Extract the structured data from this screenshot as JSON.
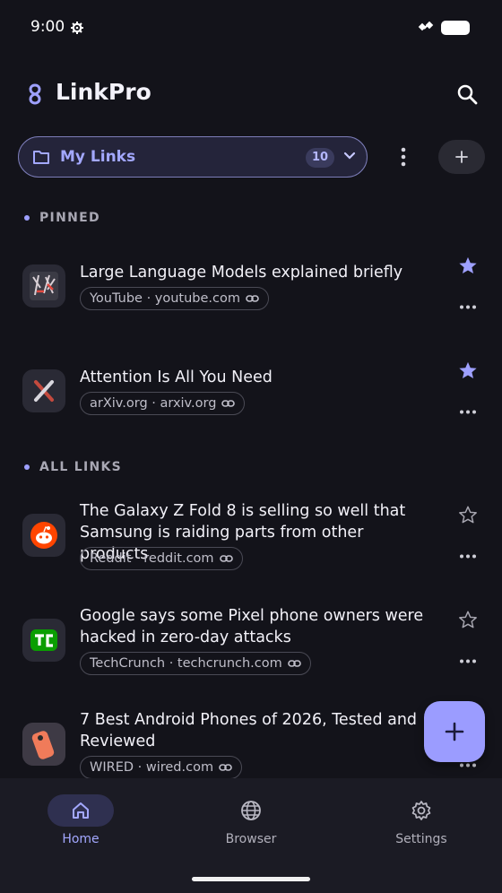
{
  "status_bar": {
    "time": "9:00"
  },
  "app": {
    "title": "LinkPro"
  },
  "collection": {
    "label": "My Links",
    "count": "10"
  },
  "sections": {
    "pinned": "PINNED",
    "all": "ALL LINKS"
  },
  "pinned": [
    {
      "title": "Large Language Models explained briefly",
      "source": "YouTube · youtube.com",
      "starred": true
    },
    {
      "title": "Attention Is All You Need",
      "source": "arXiv.org · arxiv.org",
      "starred": true
    }
  ],
  "links": [
    {
      "title": "The Galaxy Z Fold 8 is selling so well that Samsung is raiding parts from other products",
      "source": "Reddit · reddit.com",
      "starred": false
    },
    {
      "title": "Google says some Pixel phone owners were hacked in zero-day attacks",
      "source": "TechCrunch · techcrunch.com",
      "starred": false
    },
    {
      "title": "7 Best Android Phones of 2026, Tested and Reviewed",
      "source": "WIRED · wired.com",
      "starred": false
    }
  ],
  "nav": {
    "home": "Home",
    "browser": "Browser",
    "settings": "Settings"
  },
  "colors": {
    "accent": "#9b9cff",
    "background": "#13131a",
    "navbar": "#1b1b24"
  }
}
